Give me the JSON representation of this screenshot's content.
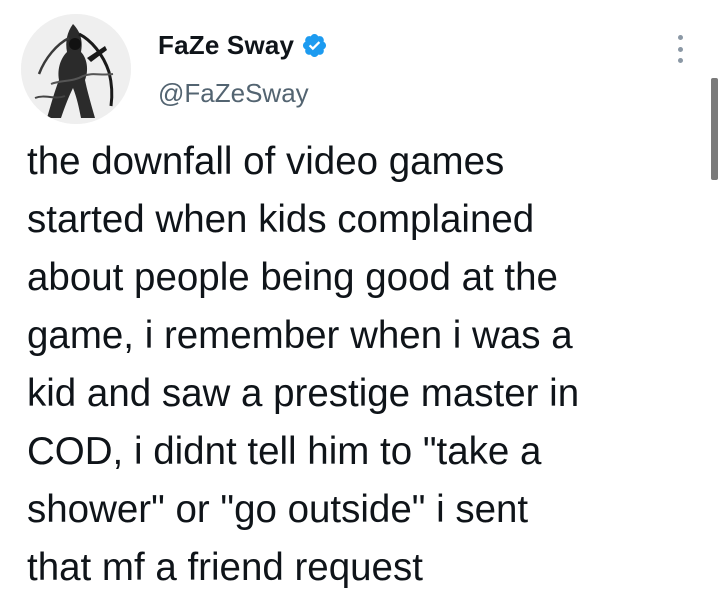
{
  "tweet": {
    "author": {
      "display_name": "FaZe Sway",
      "handle": "@FaZeSway",
      "verified": true,
      "avatar_icon": "avatar-illustration",
      "verified_color": "#1d9bf0"
    },
    "text": "the downfall of video games\nstarted when kids complained\nabout people being good at the\ngame, i remember when i was a\nkid and saw a prestige master in\nCOD, i didnt tell him to \"take a\nshower\" or \"go outside\" i sent\nthat mf a friend request",
    "more_icon": "more-vertical-icon"
  }
}
